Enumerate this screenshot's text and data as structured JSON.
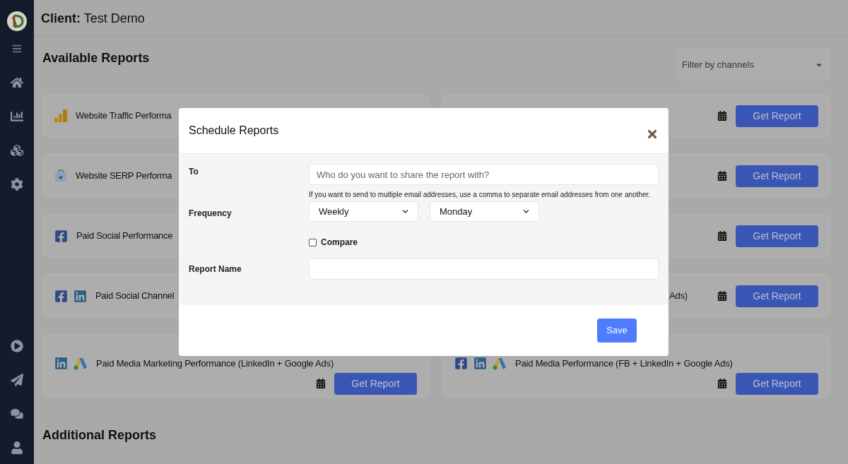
{
  "header": {
    "label": "Client:",
    "value": "Test Demo"
  },
  "available_reports": {
    "title": "Available Reports",
    "filter": {
      "placeholder": "Filter by channels"
    },
    "rows": [
      {
        "left": {
          "kind": "inline",
          "icons": [
            {
              "kind": "analytics"
            }
          ],
          "title": "Website Traffic Performa"
        },
        "right": {
          "kind": "inline",
          "button": "Get Report"
        }
      },
      {
        "left": {
          "kind": "inline",
          "icons": [
            {
              "kind": "serp"
            }
          ],
          "title": "Website SERP Performa"
        },
        "right": {
          "kind": "inline",
          "button": "Get Report"
        }
      },
      {
        "left": {
          "kind": "inline",
          "icons": [
            {
              "kind": "facebook"
            }
          ],
          "title": "Paid Social Performance"
        },
        "right": {
          "kind": "inline",
          "button": "Get Report"
        }
      },
      {
        "left": {
          "kind": "inline",
          "icons": [
            {
              "kind": "facebook"
            },
            {
              "kind": "linkedin"
            }
          ],
          "title": "Paid Social Channel"
        },
        "right": {
          "kind": "inline",
          "title": "Ads)",
          "button": "Get Report"
        }
      },
      {
        "left": {
          "kind": "stacked",
          "icons": [
            {
              "kind": "linkedin"
            },
            {
              "kind": "google_ads"
            }
          ],
          "title": "Paid Media Marketing Performance (LinkedIn + Google Ads)",
          "button": "Get Report"
        },
        "right": {
          "kind": "stacked",
          "icons": [
            {
              "kind": "facebook"
            },
            {
              "kind": "linkedin"
            },
            {
              "kind": "google_ads"
            }
          ],
          "title": "Paid Media Performance (FB + LinkedIn + Google Ads)",
          "button": "Get Report"
        }
      }
    ]
  },
  "additional_reports": {
    "title": "Additional Reports"
  },
  "modal": {
    "title": "Schedule Reports",
    "to": {
      "label": "To",
      "placeholder": "Who do you want to share the report with?",
      "hint": "If you want to send to multiple email addresses, use a comma to separate email addresses from one another."
    },
    "frequency": {
      "label": "Frequency",
      "period": "Weekly",
      "day": "Monday"
    },
    "compare": {
      "label": "Compare",
      "checked": false
    },
    "report_name": {
      "label": "Report Name"
    },
    "save": "Save"
  }
}
